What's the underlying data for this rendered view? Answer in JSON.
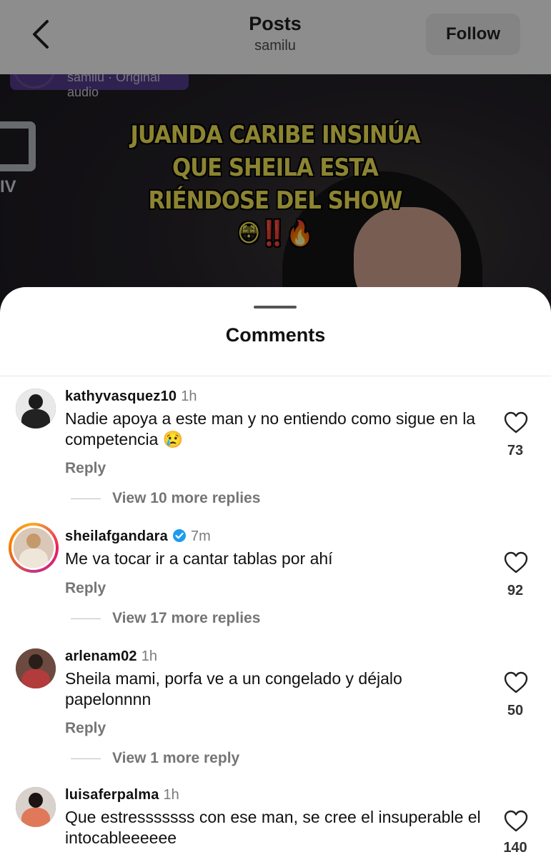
{
  "video": {
    "audio_label": "samilu · Original audio",
    "logo_sub": "IV",
    "headline": "JUANDA CARIBE INSINÚA QUE SHEILA ESTA RIÉNDOSE DEL SHOW😳‼️🔥"
  },
  "header": {
    "title": "Posts",
    "subtitle": "samilu",
    "follow_label": "Follow",
    "back_icon": "chevron-left-icon"
  },
  "comments_sheet": {
    "title": "Comments",
    "reply_label": "Reply",
    "comments": [
      {
        "username": "kathyvasquez10",
        "time": "1h",
        "verified": false,
        "text": "Nadie apoya a este man y no entiendo como sigue en la competencia 😢",
        "likes": "73",
        "view_replies": "View 10 more replies"
      },
      {
        "username": "sheilafgandara",
        "time": "7m",
        "verified": true,
        "text": "Me va tocar ir a  cantar tablas por ahí",
        "likes": "92",
        "view_replies": "View 17 more replies"
      },
      {
        "username": "arlenam02",
        "time": "1h",
        "verified": false,
        "text": "Sheila mami, porfa ve a un congelado y déjalo papelonnnn",
        "likes": "50",
        "view_replies": "View 1 more reply"
      },
      {
        "username": "luisaferpalma",
        "time": "1h",
        "verified": false,
        "text": "Que estresssssss con ese man, se cree el insuperable el intocableeeeee",
        "likes": "140"
      }
    ]
  },
  "colors": {
    "verified_blue": "#1d9bf0",
    "headline_yellow": "#f2e455",
    "story_ring": "#e91e63"
  }
}
